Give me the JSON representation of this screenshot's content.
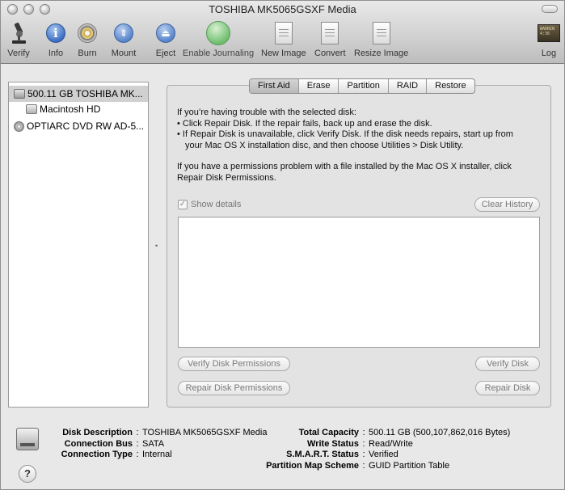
{
  "window": {
    "title": "TOSHIBA MK5065GSXF Media"
  },
  "toolbar": {
    "verify": "Verify",
    "info": "Info",
    "burn": "Burn",
    "mount": "Mount",
    "eject": "Eject",
    "enable_journaling": "Enable Journaling",
    "new_image": "New Image",
    "convert": "Convert",
    "resize_image": "Resize Image",
    "log": "Log",
    "log_icon_text": "WARNIN\n4:36"
  },
  "sidebar": {
    "items": [
      {
        "label": "500.11 GB TOSHIBA MK...",
        "icon": "hard-drive-icon",
        "selected": true
      },
      {
        "label": "Macintosh HD",
        "icon": "volume-icon",
        "selected": false
      },
      {
        "label": "OPTIARC DVD RW AD-5...",
        "icon": "optical-drive-icon",
        "selected": false
      }
    ]
  },
  "tabs": [
    "First Aid",
    "Erase",
    "Partition",
    "RAID",
    "Restore"
  ],
  "first_aid": {
    "line1": "If you’re having trouble with the selected disk:",
    "line2": "• Click Repair Disk. If the repair fails, back up and erase the disk.",
    "line3": "• If Repair Disk is unavailable, click Verify Disk. If the disk needs repairs, start up from",
    "line4": "your Mac OS X installation disc, and then choose Utilities > Disk Utility.",
    "line5": "If you have a permissions problem with a file installed by the Mac OS X installer, click",
    "line6": "Repair Disk Permissions.",
    "show_details": "Show details",
    "clear_history": "Clear History",
    "verify_permissions": "Verify Disk Permissions",
    "repair_permissions": "Repair Disk Permissions",
    "verify_disk": "Verify Disk",
    "repair_disk": "Repair Disk"
  },
  "info": {
    "disk_description_label": "Disk Description",
    "disk_description": "TOSHIBA MK5065GSXF Media",
    "connection_bus_label": "Connection Bus",
    "connection_bus": "SATA",
    "connection_type_label": "Connection Type",
    "connection_type": "Internal",
    "total_capacity_label": "Total Capacity",
    "total_capacity": "500.11 GB (500,107,862,016 Bytes)",
    "write_status_label": "Write Status",
    "write_status": "Read/Write",
    "smart_status_label": "S.M.A.R.T. Status",
    "smart_status": "Verified",
    "partition_scheme_label": "Partition Map Scheme",
    "partition_scheme": "GUID Partition Table",
    "colon": ":"
  },
  "help_button": "?"
}
